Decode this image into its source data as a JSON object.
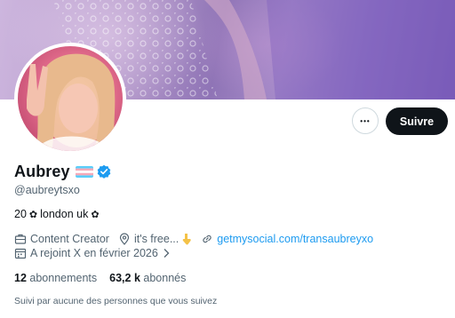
{
  "profile": {
    "display_name": "Aubrey",
    "handle": "@aubreytsxo",
    "bio_prefix": "20",
    "bio_location": "london uk",
    "bio_flower": "✿",
    "flag_colors": [
      "#5bcefa",
      "#f5a9b8",
      "#ffffff",
      "#f5a9b8",
      "#5bcefa"
    ],
    "verified_color": "#1d9bf0"
  },
  "actions": {
    "more_label": "•••",
    "follow_label": "Suivre"
  },
  "meta": {
    "category": "Content Creator",
    "location": "it's free...",
    "link": "getmysocial.com/transaubreyxo",
    "joined": "A rejoint X en février 2026"
  },
  "stats": {
    "following_count": "12",
    "following_label": "abonnements",
    "followers_count": "63,2 k",
    "followers_label": "abonnés"
  },
  "followed_by": "Suivi par aucune des personnes que vous suivez"
}
